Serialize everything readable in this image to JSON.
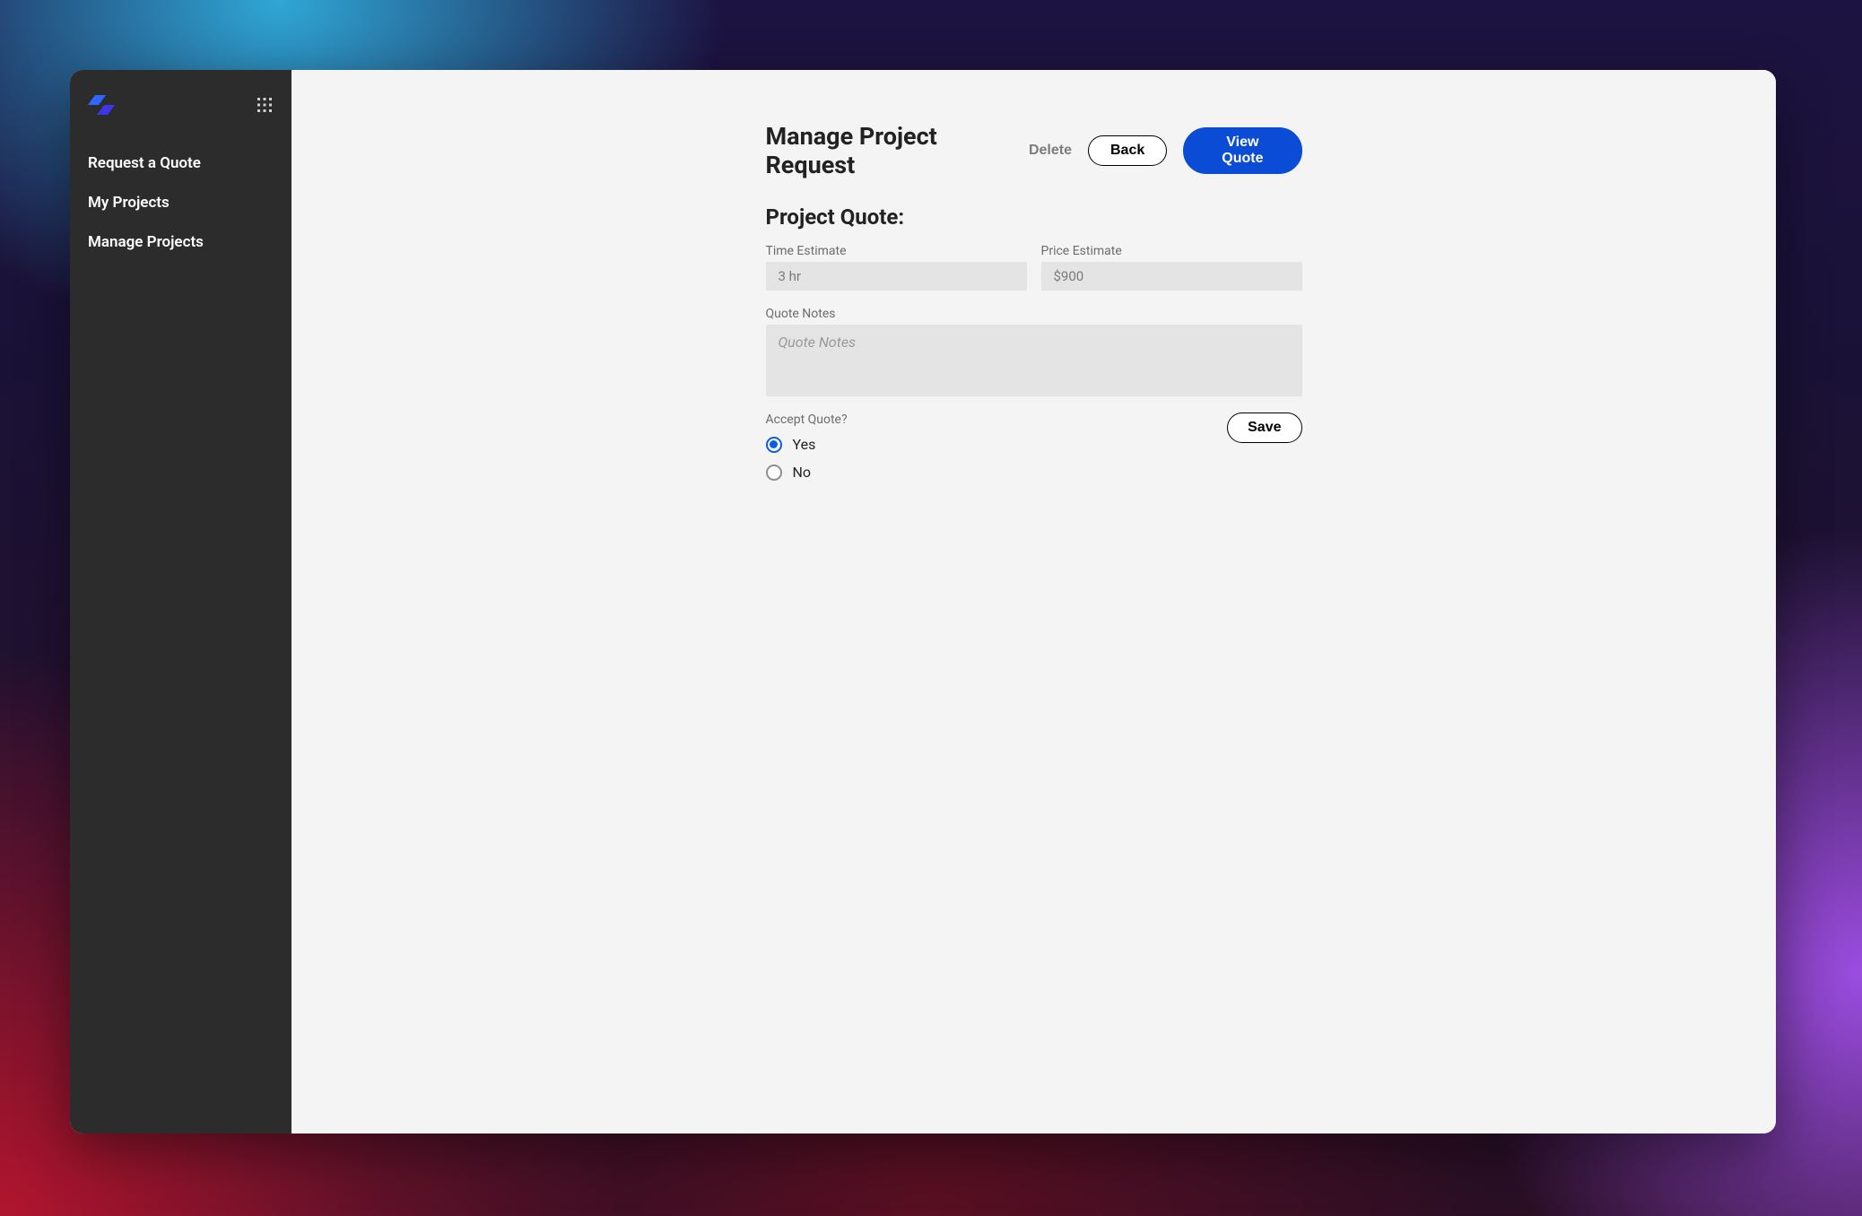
{
  "sidebar": {
    "nav": [
      {
        "label": "Request a Quote"
      },
      {
        "label": "My Projects"
      },
      {
        "label": "Manage Projects"
      }
    ]
  },
  "header": {
    "title": "Manage Project Request",
    "delete_label": "Delete",
    "back_label": "Back",
    "view_quote_label": "View Quote"
  },
  "section": {
    "title": "Project Quote:"
  },
  "fields": {
    "time_estimate": {
      "label": "Time Estimate",
      "value": "3 hr"
    },
    "price_estimate": {
      "label": "Price Estimate",
      "value": "$900"
    },
    "quote_notes": {
      "label": "Quote Notes",
      "placeholder": "Quote Notes",
      "value": ""
    }
  },
  "accept": {
    "label": "Accept Quote?",
    "yes_label": "Yes",
    "no_label": "No",
    "selected": "yes"
  },
  "save_label": "Save"
}
